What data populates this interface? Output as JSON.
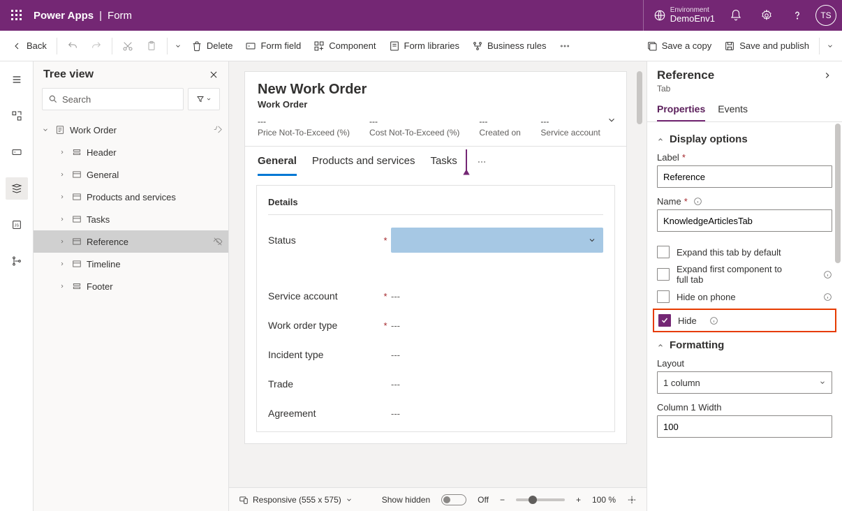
{
  "header": {
    "app": "Power Apps",
    "page": "Form",
    "env_label": "Environment",
    "env_name": "DemoEnv1",
    "avatar_initials": "TS"
  },
  "cmd": {
    "back": "Back",
    "delete": "Delete",
    "form_field": "Form field",
    "component": "Component",
    "form_libraries": "Form libraries",
    "business_rules": "Business rules",
    "save_copy": "Save a copy",
    "save_publish": "Save and publish"
  },
  "tree": {
    "title": "Tree view",
    "search_placeholder": "Search",
    "root": "Work Order",
    "items": [
      "Header",
      "General",
      "Products and services",
      "Tasks",
      "Reference",
      "Timeline",
      "Footer"
    ],
    "selected": "Reference"
  },
  "form": {
    "title": "New Work Order",
    "subtitle": "Work Order",
    "stats": [
      {
        "value": "---",
        "label": "Price Not-To-Exceed (%)"
      },
      {
        "value": "---",
        "label": "Cost Not-To-Exceed (%)"
      },
      {
        "value": "---",
        "label": "Created on"
      },
      {
        "value": "---",
        "label": "Service account"
      }
    ],
    "tabs": [
      "General",
      "Products and services",
      "Tasks"
    ],
    "active_tab": "General",
    "section_title": "Details",
    "fields": [
      {
        "label": "Status",
        "required": true,
        "value": "",
        "kind": "status"
      },
      {
        "label": "Service account",
        "required": true,
        "value": "---"
      },
      {
        "label": "Work order type",
        "required": true,
        "value": "---"
      },
      {
        "label": "Incident type",
        "required": false,
        "value": "---"
      },
      {
        "label": "Trade",
        "required": false,
        "value": "---"
      },
      {
        "label": "Agreement",
        "required": false,
        "value": "---"
      }
    ]
  },
  "statusbar": {
    "responsive": "Responsive (555 x 575)",
    "show_hidden": "Show hidden",
    "toggle_state": "Off",
    "zoom_pct": "100 %"
  },
  "props": {
    "title": "Reference",
    "type": "Tab",
    "tabs": [
      "Properties",
      "Events"
    ],
    "active_tab": "Properties",
    "group_display": "Display options",
    "label_field": "Label",
    "label_value": "Reference",
    "name_field": "Name",
    "name_value": "KnowledgeArticlesTab",
    "check_expand": "Expand this tab by default",
    "check_expand_first": "Expand first component to full tab",
    "check_hide_phone": "Hide on phone",
    "check_hide": "Hide",
    "group_format": "Formatting",
    "layout_label": "Layout",
    "layout_value": "1 column",
    "col1w_label": "Column 1 Width",
    "col1w_value": "100"
  }
}
